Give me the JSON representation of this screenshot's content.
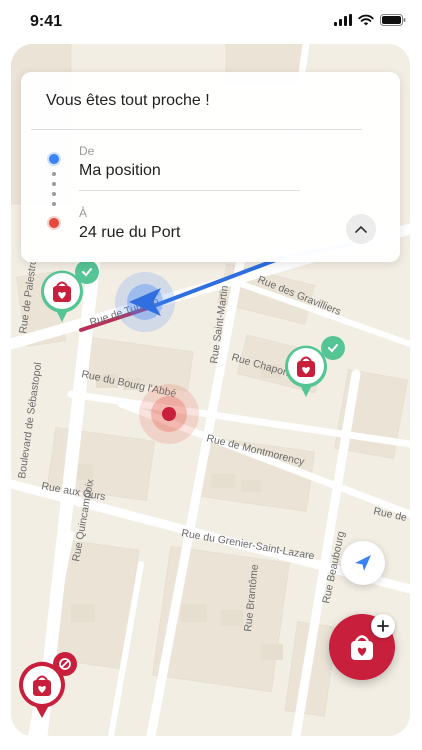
{
  "status_bar": {
    "time": "9:41"
  },
  "route_card": {
    "title": "Vous êtes tout proche !",
    "from_label": "De",
    "from_value": "Ma position",
    "to_label": "À",
    "to_value": "24 rue du Port"
  },
  "map": {
    "streets": [
      "Rue de Palestro",
      "Rue Saint-Martin",
      "Rue des Gravilliers",
      "Rue de Turbigo",
      "Rue Chapon",
      "Boulevard de Sébastopol",
      "Rue du Bourg l'Abbé",
      "Rue de Montmorency",
      "Rue aux Ours",
      "Rue Quincampoix",
      "Rue du Grenier-Saint-Lazare",
      "Rue Brantôme",
      "Rue Beaubourg",
      "Rue de"
    ]
  },
  "colors": {
    "accent_blue": "#3b82f6",
    "aed_red": "#c8203c",
    "status_green": "#56c596",
    "destination_red": "#e24a3b"
  },
  "icons": {
    "locate": "navigation-arrow-icon",
    "add": "plus-icon",
    "collapse": "chevron-up-icon",
    "aed": "defibrillator-bag-icon"
  }
}
